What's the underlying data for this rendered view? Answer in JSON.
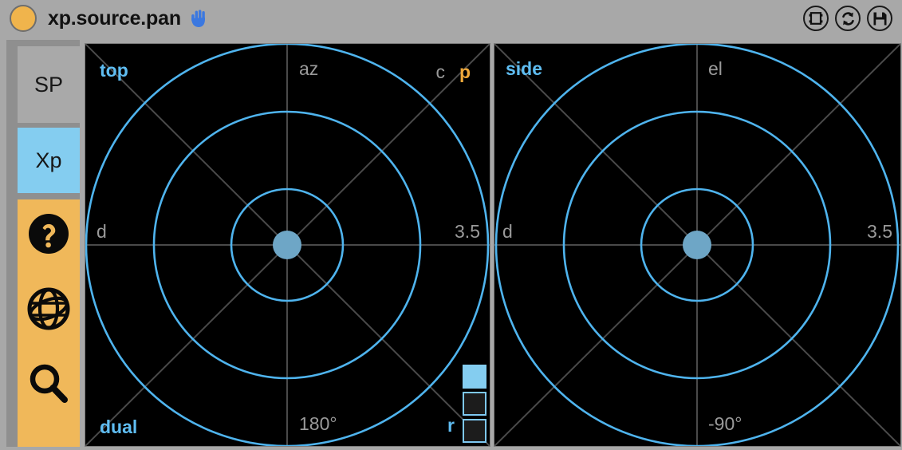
{
  "window": {
    "title": "xp.source.pan",
    "status_dot_color": "#f0b44c",
    "hand_icon": "hand-icon",
    "titlebar_icons": [
      {
        "name": "patcher-window-icon",
        "glyph": "patcher"
      },
      {
        "name": "refresh-icon",
        "glyph": "refresh"
      },
      {
        "name": "save-icon",
        "glyph": "floppy"
      }
    ]
  },
  "sidebar": {
    "items": [
      {
        "name": "sidebar-item-sp",
        "label": "SP",
        "active": false,
        "color": "#a9a9a9"
      },
      {
        "name": "sidebar-item-xp",
        "label": "Xp",
        "active": true,
        "color": "#84cdf0"
      }
    ],
    "tools_panel_color": "#f0b85a",
    "tools": [
      {
        "name": "help-icon",
        "label": "help"
      },
      {
        "name": "globe-icon",
        "label": "globe"
      },
      {
        "name": "search-icon",
        "label": "search"
      }
    ]
  },
  "panels": [
    {
      "id": "panel-top",
      "view_label": "top",
      "axis_top_label": "az",
      "axis_left_label": "d",
      "axis_right_label": "3.5",
      "axis_bottom_label": "180°",
      "mode_label": "dual",
      "corner_c_label": "c",
      "corner_p_label": "p",
      "toggle_label": "r",
      "ring_count": 3,
      "accent_color": "#5fbdf2",
      "source_color": "#6ea6c6"
    },
    {
      "id": "panel-side",
      "view_label": "side",
      "axis_top_label": "el",
      "axis_left_label": "d",
      "axis_right_label": "3.5",
      "axis_bottom_label": "-90°",
      "ring_count": 3,
      "accent_color": "#5fbdf2",
      "source_color": "#6ea6c6"
    }
  ],
  "toggles": [
    {
      "name": "toggle-display-1",
      "state": "on"
    },
    {
      "name": "toggle-display-2",
      "state": "off"
    },
    {
      "name": "toggle-display-3",
      "state": "off"
    }
  ],
  "colors": {
    "background": "#a8a8a8",
    "panel_bg": "#000000",
    "accent_blue": "#5fbdf2",
    "accent_orange": "#f0a93a",
    "grid_gray": "#4a4a4a",
    "label_gray": "#9a9a9a"
  }
}
